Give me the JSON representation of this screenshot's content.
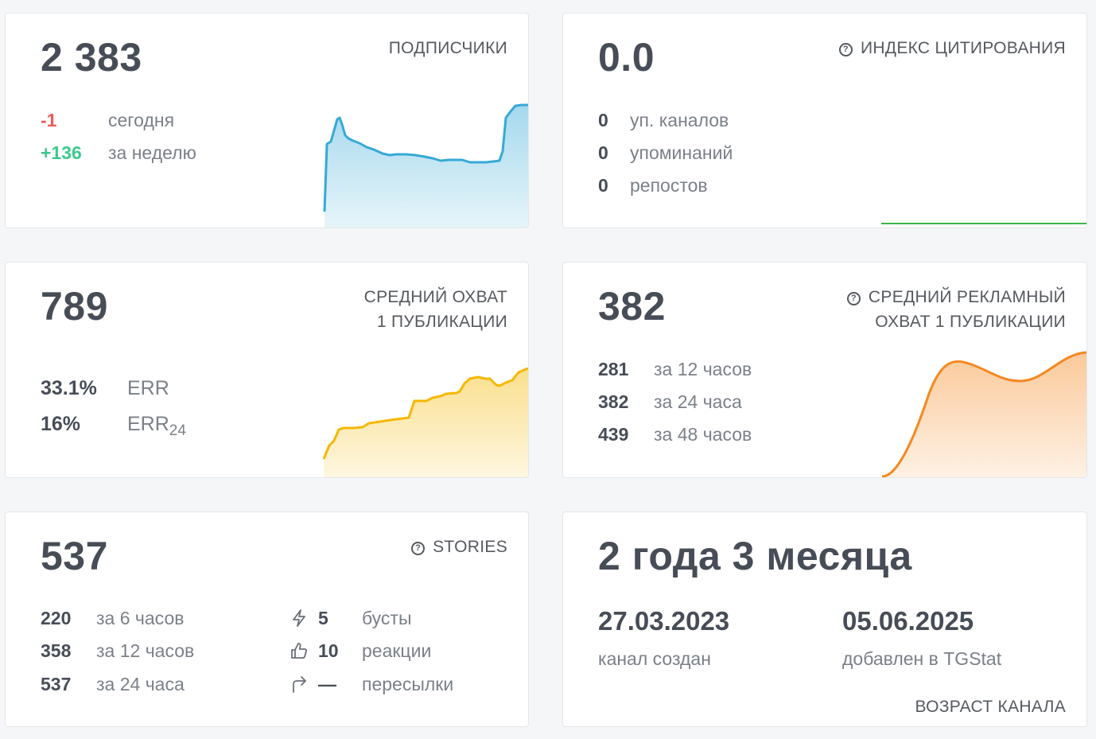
{
  "subscribers": {
    "value": "2 383",
    "title": "ПОДПИСЧИКИ",
    "today_delta": "-1",
    "today_label": "сегодня",
    "week_delta": "+136",
    "week_label": "за неделю",
    "chart_color": "#36a9d6"
  },
  "citation": {
    "value": "0.0",
    "title": "ИНДЕКС ЦИТИРОВАНИЯ",
    "rows": [
      {
        "num": "0",
        "label": "уп. каналов"
      },
      {
        "num": "0",
        "label": "упоминаний"
      },
      {
        "num": "0",
        "label": "репостов"
      }
    ],
    "chart_color": "#3cb54a"
  },
  "reach": {
    "value": "789",
    "title_line1": "СРЕДНИЙ ОХВАТ",
    "title_line2": "1 ПУБЛИКАЦИИ",
    "err_value": "33.1%",
    "err_label": "ERR",
    "err24_value": "16%",
    "err24_label": "ERR",
    "err24_sub": "24",
    "chart_color": "#f5b800"
  },
  "ad_reach": {
    "value": "382",
    "title_line1": "СРЕДНИЙ РЕКЛАМНЫЙ",
    "title_line2": "ОХВАТ 1 ПУБЛИКАЦИИ",
    "rows": [
      {
        "num": "281",
        "label": "за 12 часов"
      },
      {
        "num": "382",
        "label": "за 24 часа"
      },
      {
        "num": "439",
        "label": "за 48 часов"
      }
    ],
    "chart_color": "#f5881f"
  },
  "stories": {
    "value": "537",
    "title": "STORIES",
    "rows": [
      {
        "num": "220",
        "label": "за 6 часов"
      },
      {
        "num": "358",
        "label": "за 12 часов"
      },
      {
        "num": "537",
        "label": "за 24 часа"
      }
    ],
    "extras": [
      {
        "icon": "lightning-icon",
        "num": "5",
        "label": "бусты"
      },
      {
        "icon": "thumbs-up-icon",
        "num": "10",
        "label": "реакции"
      },
      {
        "icon": "forward-arrow-icon",
        "num": "—",
        "label": "пересылки"
      }
    ]
  },
  "age": {
    "value": "2 года 3 месяца",
    "created_date": "27.03.2023",
    "created_label": "канал создан",
    "added_date": "05.06.2025",
    "added_label": "добавлен в TGStat",
    "title": "ВОЗРАСТ КАНАЛА"
  }
}
